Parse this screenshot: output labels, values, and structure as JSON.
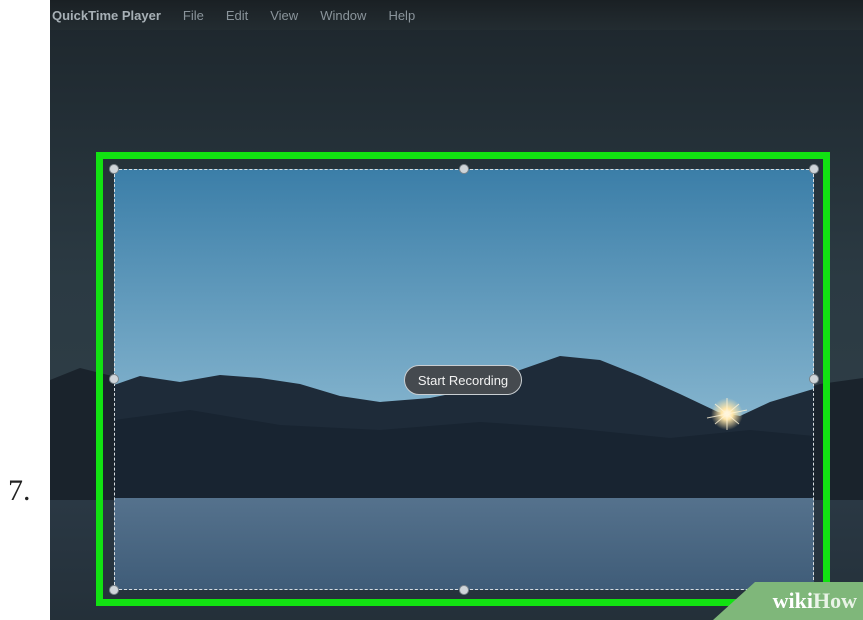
{
  "step_number": "7.",
  "menubar": {
    "app_name": "QuickTime Player",
    "items": [
      "File",
      "Edit",
      "View",
      "Window",
      "Help"
    ]
  },
  "recording": {
    "button_label": "Start Recording"
  },
  "watermark": {
    "part1": "wiki",
    "part2": "How"
  },
  "colors": {
    "highlight_frame": "#12e212",
    "sky_top": "#3d7fa8",
    "sky_horizon": "#c4d2d8",
    "mountains": "#1d2a38",
    "lake": "#4a6884",
    "button_bg": "#454a4f"
  }
}
